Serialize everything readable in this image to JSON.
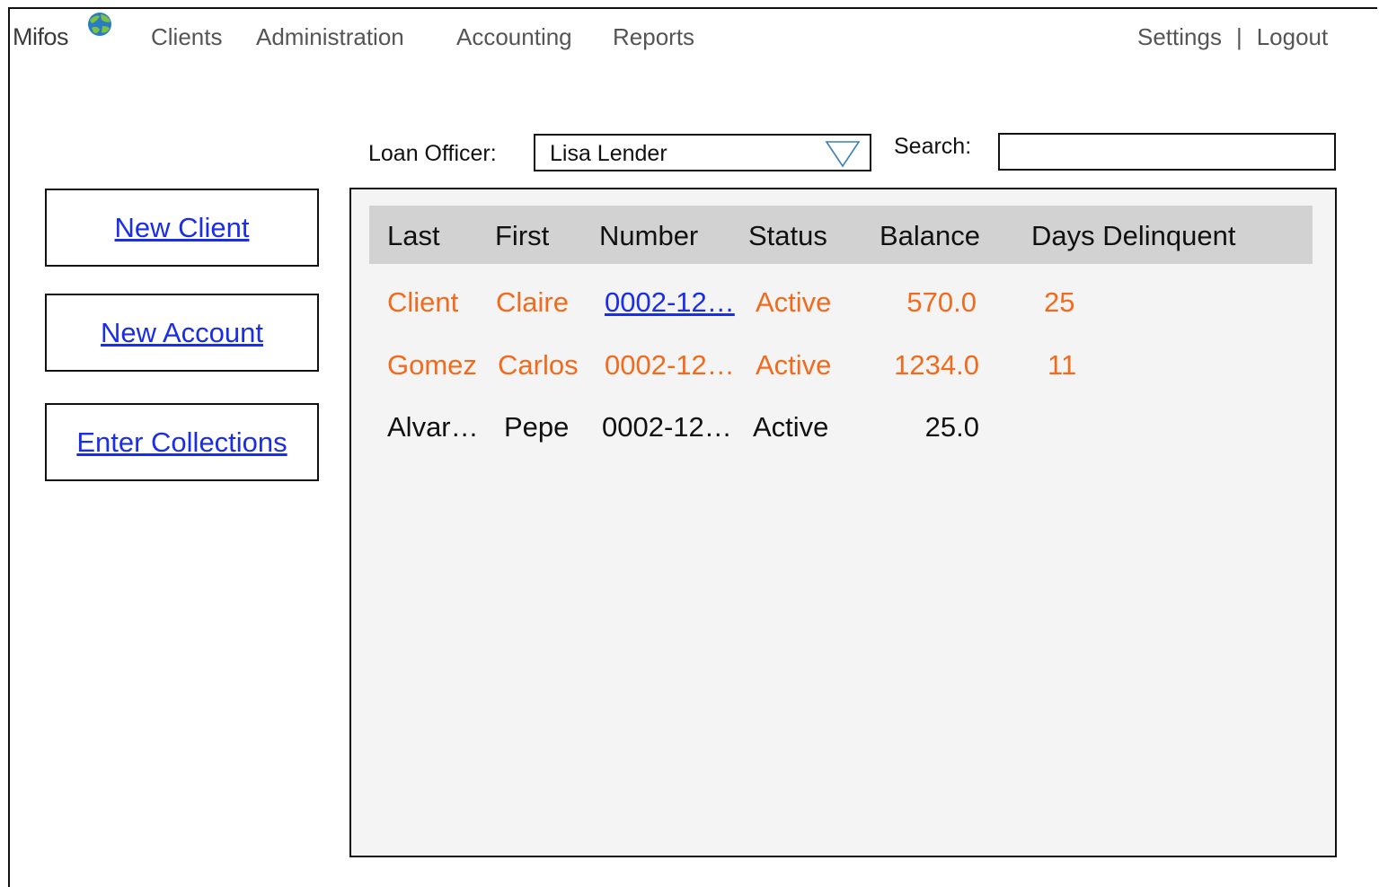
{
  "app": {
    "logo_text": "Mifos"
  },
  "nav": {
    "items": [
      "Clients",
      "Administration",
      "Accounting",
      "Reports"
    ],
    "settings": "Settings",
    "separator": "|",
    "logout": "Logout"
  },
  "filters": {
    "loan_officer_label": "Loan Officer:",
    "loan_officer_value": "Lisa Lender",
    "search_label": "Search:",
    "search_value": ""
  },
  "actions": {
    "new_client": "New Client",
    "new_account": "New Account",
    "enter_collections": "Enter Collections"
  },
  "table": {
    "headers": [
      "Last",
      "First",
      "Number",
      "Status",
      "Balance",
      "Days Delinquent"
    ],
    "rows": [
      {
        "last": "Client",
        "first": "Claire",
        "number": "0002-12… ",
        "status": "Active",
        "balance": "570.0",
        "days": "25",
        "highlight": "delinquent",
        "number_link": true
      },
      {
        "last": "Gomez",
        "first": "Carlos",
        "number": "0002-12…",
        "status": "Active",
        "balance": "1234.0",
        "days": "11",
        "highlight": "delinquent",
        "number_link": false
      },
      {
        "last": "Alvar…",
        "first": "Pepe",
        "number": "0002-12…",
        "status": "Active",
        "balance": "25.0",
        "days": "",
        "highlight": "normal",
        "number_link": false
      }
    ]
  },
  "colors": {
    "delinquent_text": "#f26b1d",
    "link": "#1a2ee8",
    "header_bg": "#d2d2d2",
    "panel_bg": "#f4f4f4"
  }
}
